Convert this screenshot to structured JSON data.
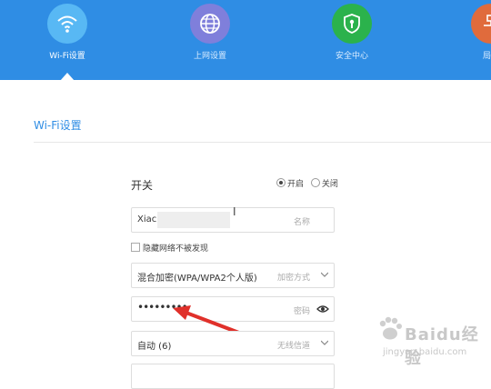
{
  "nav": [
    {
      "label": "Wi-Fi设置",
      "color": "#58b8f4",
      "icon": "wifi-icon"
    },
    {
      "label": "上网设置",
      "color": "#7f7fdb",
      "icon": "globe-icon"
    },
    {
      "label": "安全中心",
      "color": "#2bb24c",
      "icon": "shield-icon"
    },
    {
      "label": "局域",
      "color": "#e06b3c",
      "icon": "lan-icon"
    }
  ],
  "colors": {
    "header": "#2f8de4",
    "accent": "#2f8de4",
    "arrow": "#e0302a"
  },
  "page": {
    "title": "Wi-Fi设置"
  },
  "form": {
    "switch_label": "开关",
    "switch_on": "开启",
    "switch_off": "关闭",
    "name_value": "Xiac",
    "name_placeholder": "名称",
    "hide_network": "隐藏网络不被发现",
    "encryption_value": "混合加密(WPA/WPA2个人版)",
    "encryption_placeholder": "加密方式",
    "password_value": "•••••••••",
    "password_placeholder": "密码",
    "channel_value": "自动 (6)",
    "channel_placeholder": "无线信道"
  },
  "watermark": {
    "text": "Baidu经验",
    "sub": "jingyan.baidu.com"
  }
}
